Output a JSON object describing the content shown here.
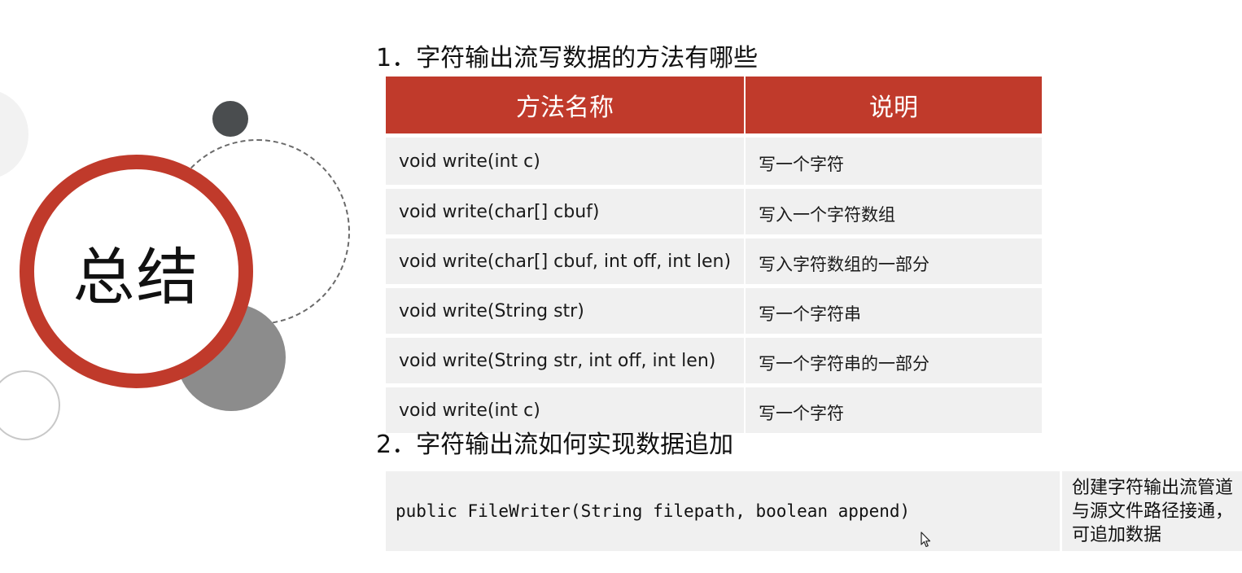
{
  "slide": {
    "badge_title": "总结",
    "q1_title": "1．字符输出流写数据的方法有哪些",
    "table": {
      "headers": [
        "方法名称",
        "说明"
      ],
      "rows": [
        {
          "method": "void write(int c)",
          "desc": "写一个字符"
        },
        {
          "method": "void write(char[] cbuf)",
          "desc": "写入一个字符数组"
        },
        {
          "method": "void write(char[] cbuf, int off, int len)",
          "desc": "写入字符数组的一部分"
        },
        {
          "method": "void write(String str)",
          "desc": "写一个字符串"
        },
        {
          "method": "void write(String str, int off, int len)",
          "desc": "写一个字符串的一部分"
        },
        {
          "method": "void write(int c)",
          "desc": "写一个字符"
        }
      ]
    },
    "q2_title": "2．字符输出流如何实现数据追加",
    "constructor_code": "public FileWriter(String filepath, boolean append)",
    "constructor_desc": "创建字符输出流管道与源文件路径接通，可追加数据"
  },
  "colors": {
    "accent": "#c03a2b",
    "cell_bg": "#f0f0f0",
    "dark_dot": "#4a4d4f",
    "gray_circle": "#8c8c8c"
  }
}
